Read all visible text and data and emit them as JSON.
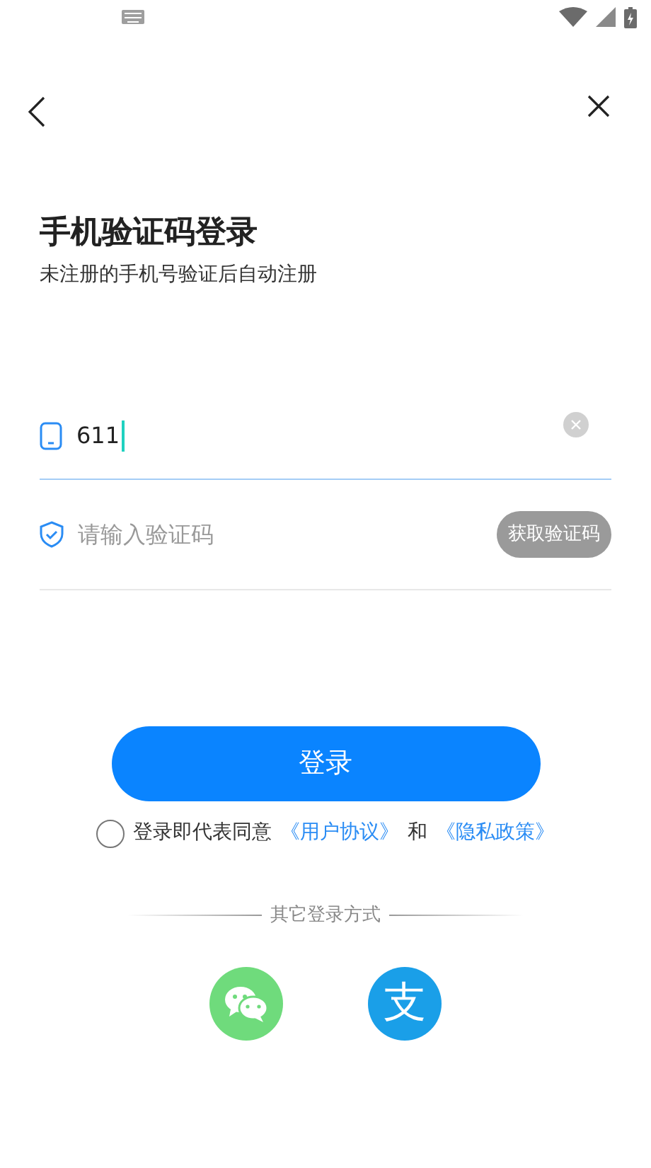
{
  "title": "手机验证码登录",
  "subtitle": "未注册的手机号验证后自动注册",
  "phone_field": {
    "value": "611",
    "focused": true
  },
  "code_field": {
    "placeholder": "请输入验证码",
    "button": {
      "label": "获取验证码",
      "disabled": true
    }
  },
  "login_button": {
    "label": "登录"
  },
  "agreement": {
    "checked": false,
    "text": "登录即代表同意",
    "links": [
      "《用户协议》",
      "《隐私政策》"
    ],
    "conjunction": "和"
  },
  "other_login": {
    "label": "其它登录方式",
    "options": [
      {
        "kind": "wechat"
      },
      {
        "kind": "alipay",
        "glyph": "支"
      }
    ]
  }
}
